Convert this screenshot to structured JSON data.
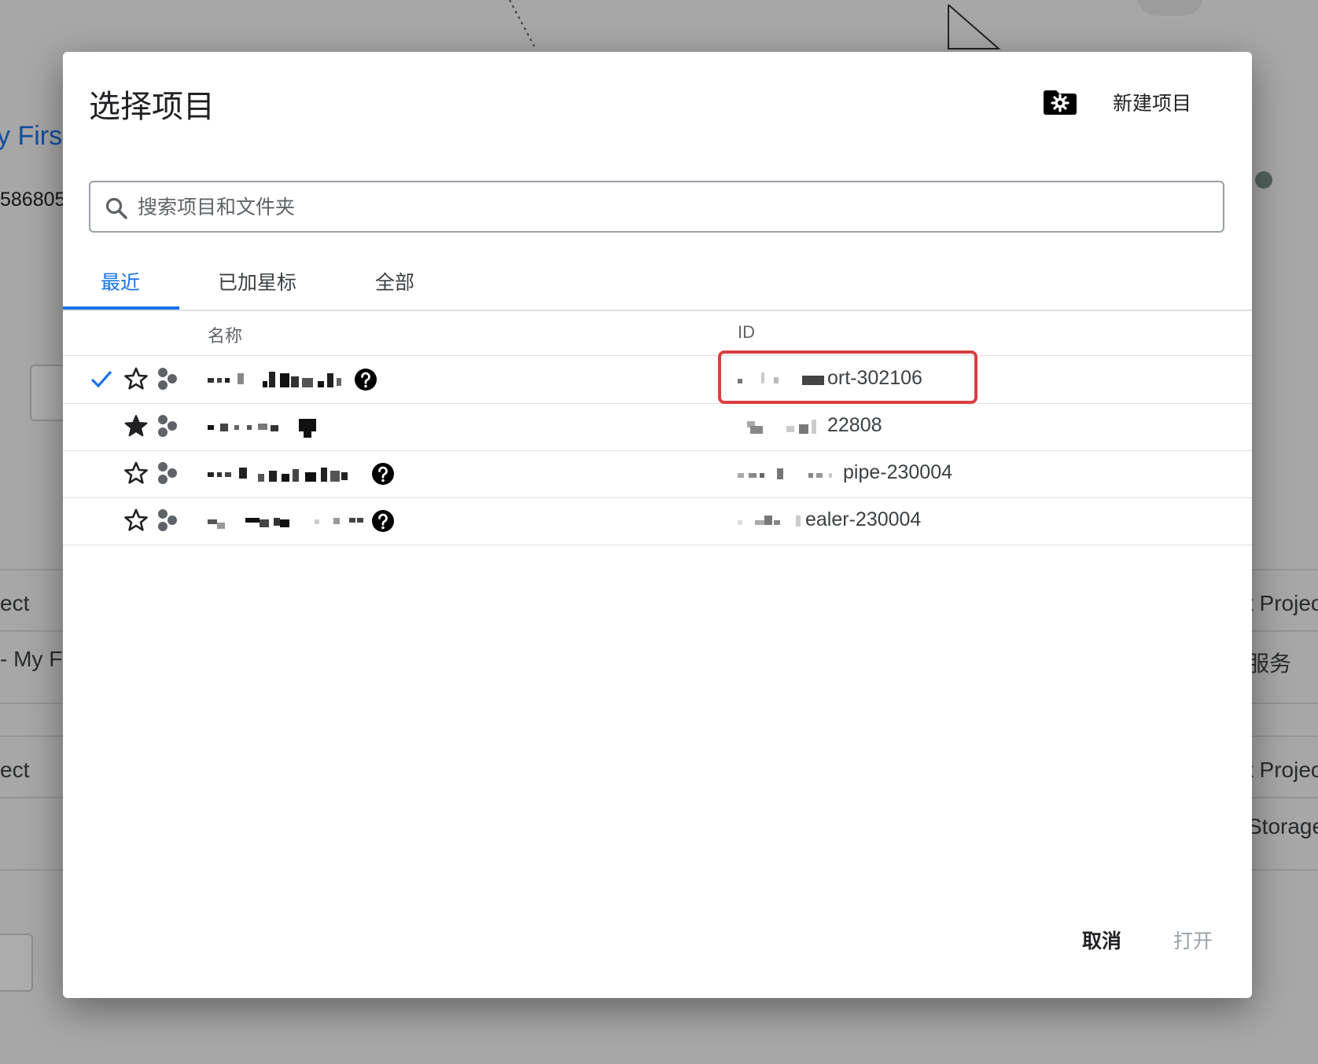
{
  "background": {
    "fragments": [
      "y Firs",
      "586805",
      "ect",
      "- My Fi",
      "ect",
      "t Projec",
      "服务",
      "t Projec",
      "Storage"
    ]
  },
  "dialog": {
    "title": "选择项目",
    "manage_icon": "folder-gear-icon",
    "new_project_label": "新建项目",
    "search": {
      "placeholder": "搜索项目和文件夹",
      "value": ""
    },
    "tabs": [
      {
        "label": "最近",
        "active": true
      },
      {
        "label": "已加星标",
        "active": false
      },
      {
        "label": "全部",
        "active": false
      }
    ],
    "columns": {
      "name": "名称",
      "id": "ID"
    },
    "rows": [
      {
        "selected": true,
        "starred": false,
        "name_redacted": true,
        "help": true,
        "id_visible": "ort-302106"
      },
      {
        "selected": false,
        "starred": true,
        "name_redacted": true,
        "help": false,
        "id_visible": "22808"
      },
      {
        "selected": false,
        "starred": false,
        "name_redacted": true,
        "help": true,
        "id_visible": "pipe-230004"
      },
      {
        "selected": false,
        "starred": false,
        "name_redacted": true,
        "help": true,
        "id_visible": "ealer-230004"
      }
    ],
    "highlight_color": "#d93f3f",
    "accent_color": "#1a73e8",
    "buttons": {
      "cancel": "取消",
      "open": "打开"
    }
  }
}
